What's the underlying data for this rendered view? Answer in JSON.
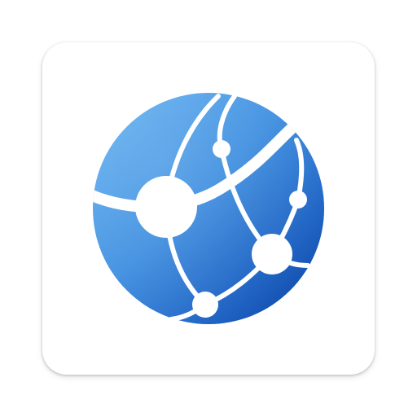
{
  "app_icon": {
    "icon": "network-globe-icon",
    "colors": {
      "tile": "#ffffff",
      "globe_light": "#63b0f1",
      "globe_mid": "#3f8fe0",
      "globe_dark": "#0a46a6",
      "connector": "#ffffff"
    }
  }
}
